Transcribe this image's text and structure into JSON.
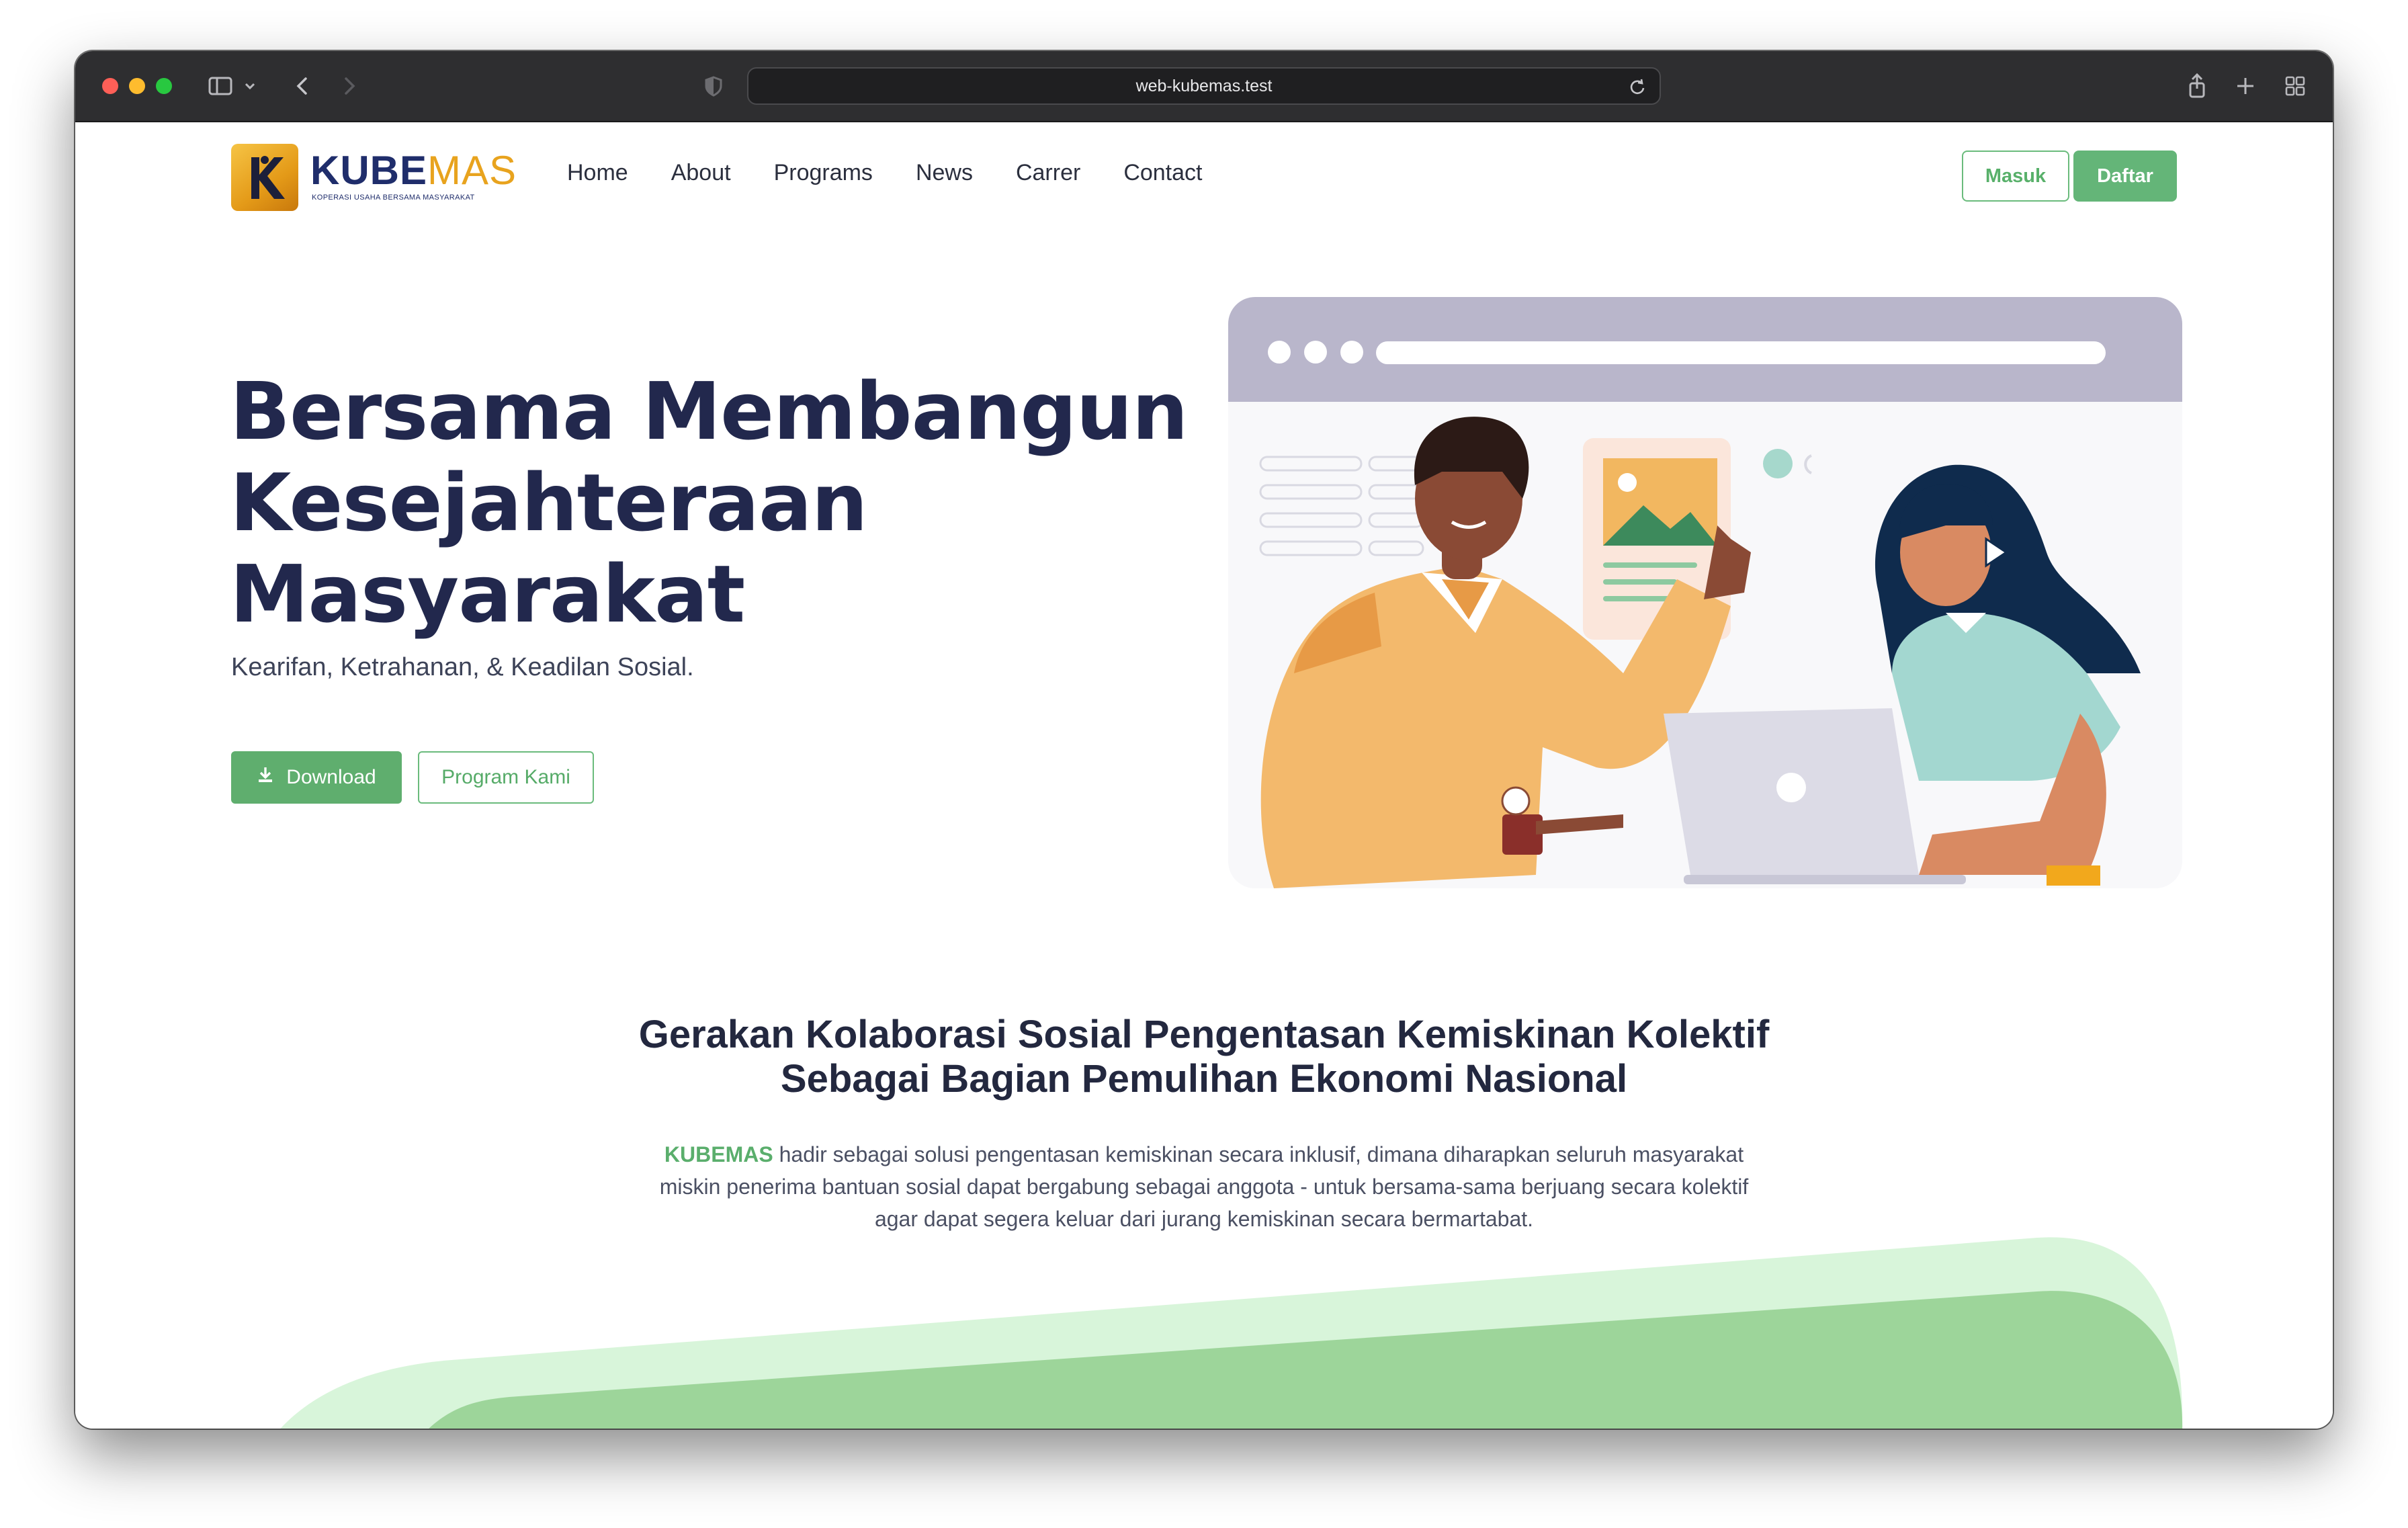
{
  "browser": {
    "url": "web-kubemas.test"
  },
  "brand": {
    "name_primary": "KUBE",
    "name_accent": "MAS",
    "tagline": "KOPERASI USAHA BERSAMA MASYARAKAT"
  },
  "nav": {
    "items": [
      {
        "label": "Home"
      },
      {
        "label": "About"
      },
      {
        "label": "Programs"
      },
      {
        "label": "News"
      },
      {
        "label": "Carrer"
      },
      {
        "label": "Contact"
      }
    ],
    "login_label": "Masuk",
    "register_label": "Daftar"
  },
  "hero": {
    "title_lines": [
      "Bersama Membangun",
      "Kesejahteraan",
      "Masyarakat"
    ],
    "subtitle": "Kearifan, Ketrahanan, & Keadilan Sosial.",
    "download_label": "Download",
    "program_label": "Program Kami"
  },
  "section": {
    "heading_line1": "Gerakan Kolaborasi Sosial Pengentasan Kemiskinan Kolektif",
    "heading_line2": "Sebagai Bagian Pemulihan Ekonomi Nasional",
    "brand_word": "KUBEMAS",
    "body_line1": " hadir sebagai solusi pengentasan kemiskinan secara inklusif, dimana diharapkan seluruh masyarakat",
    "body_line2": "miskin penerima bantuan sosial dapat bergabung sebagai anggota - untuk bersama-sama berjuang secara kolektif",
    "body_line3": "agar dapat segera keluar dari jurang kemiskinan secara bermartabat."
  },
  "colors": {
    "accent_green": "#64b578",
    "heading_navy": "#22284d",
    "logo_gold": "#e8a31e",
    "wave_light": "#d8f5da",
    "wave_dark": "#9dd59a"
  }
}
